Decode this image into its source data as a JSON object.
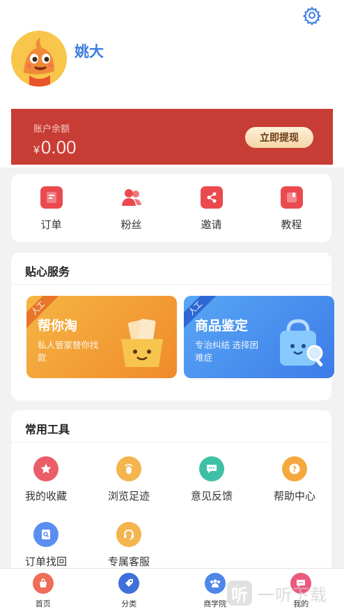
{
  "profile": {
    "username": "姚大"
  },
  "balance": {
    "label": "账户余额",
    "currency": "¥",
    "amount": "0.00",
    "withdraw_label": "立即提现"
  },
  "quick_actions": [
    {
      "label": "订单",
      "icon": "order-icon",
      "color": "#ea4a4f"
    },
    {
      "label": "粉丝",
      "icon": "fans-icon",
      "color": "#ea4a4f"
    },
    {
      "label": "邀请",
      "icon": "share-icon",
      "color": "#ea4a4f"
    },
    {
      "label": "教程",
      "icon": "tutorial-icon",
      "color": "#ea4a4f"
    }
  ],
  "service": {
    "title": "贴心服务",
    "promos": [
      {
        "badge": "人工",
        "title": "帮你淘",
        "desc": "私人管家替你找款"
      },
      {
        "badge": "人工",
        "title": "商品鉴定",
        "desc": "专治纠结 选择困难症"
      }
    ]
  },
  "tools": {
    "title": "常用工具",
    "items": [
      {
        "label": "我的收藏",
        "icon": "star-icon",
        "color": "#ec5d6a"
      },
      {
        "label": "浏览足迹",
        "icon": "footprint-icon",
        "color": "#f4b44e"
      },
      {
        "label": "意见反馈",
        "icon": "feedback-icon",
        "color": "#3fc0a6"
      },
      {
        "label": "帮助中心",
        "icon": "help-icon",
        "color": "#f5a93c"
      },
      {
        "label": "订单找回",
        "icon": "order-search-icon",
        "color": "#5b8ef0"
      },
      {
        "label": "专属客服",
        "icon": "customer-service-icon",
        "color": "#f4b44e"
      }
    ]
  },
  "tabbar": [
    {
      "label": "首页",
      "icon": "home-icon",
      "color": "#ee6d56"
    },
    {
      "label": "分类",
      "icon": "category-icon",
      "color": "#3f6fd8"
    },
    {
      "label": "商学院",
      "icon": "academy-icon",
      "color": "#4f86e8"
    },
    {
      "label": "我的",
      "icon": "mine-icon",
      "color": "#ea5a7d"
    }
  ],
  "watermark": {
    "logo": "听",
    "text": "一听下载"
  },
  "colors": {
    "balance_bg": "#c73c34",
    "accent_blue": "#3a7be0",
    "accent_red": "#ea4a4f"
  }
}
